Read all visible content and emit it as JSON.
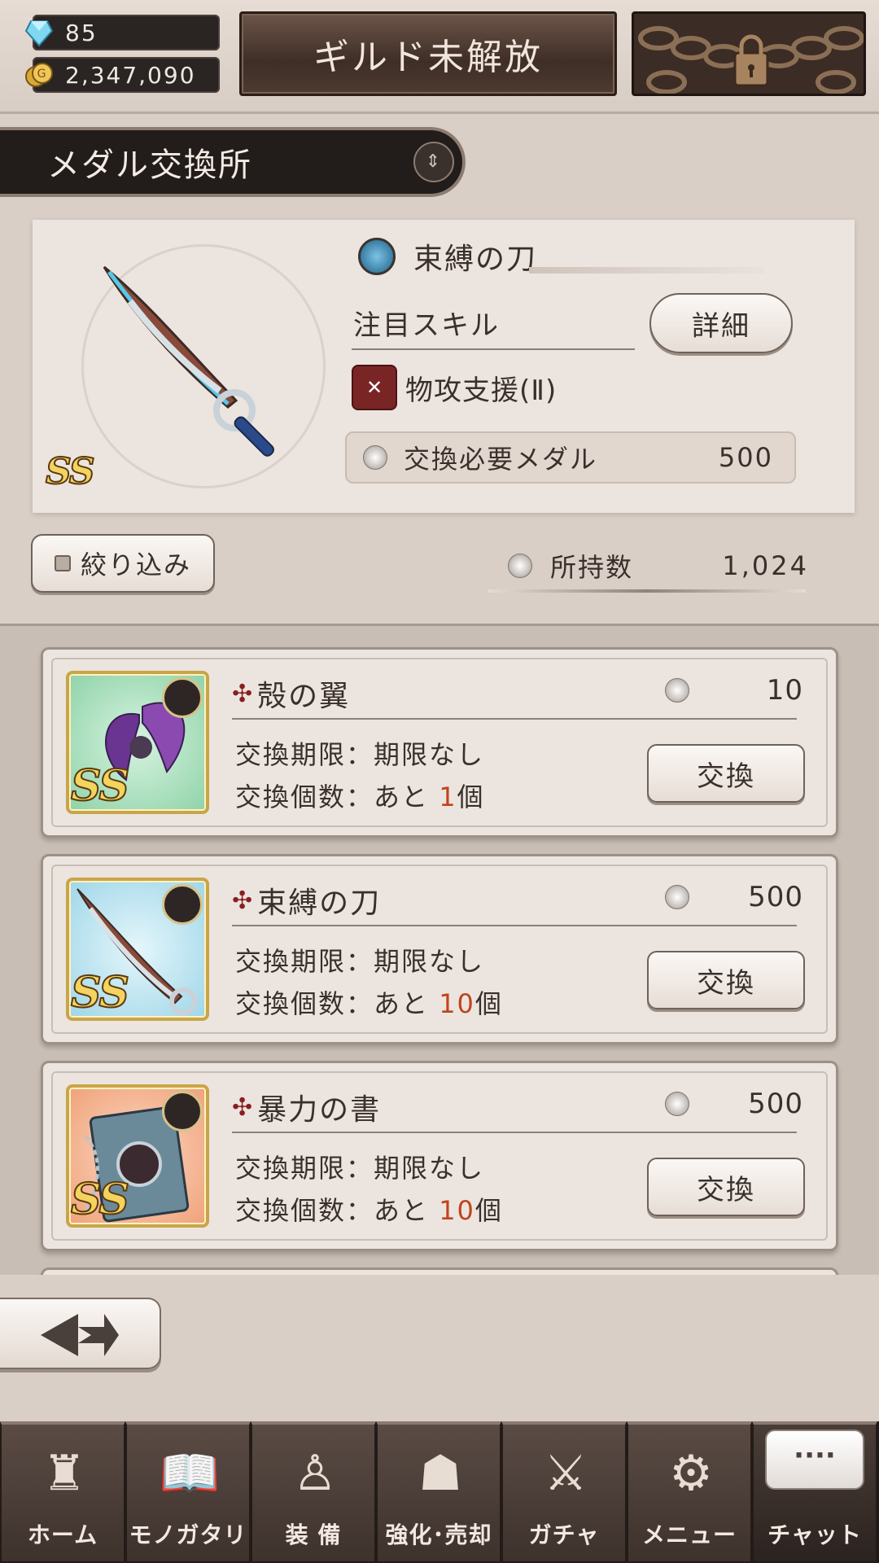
{
  "header": {
    "gems": "85",
    "coins": "2,347,090",
    "guild_button": "ギルド未解放",
    "locked_icon": "padlock-chain-icon"
  },
  "section_title": "メダル交換所",
  "detail": {
    "item_name": "束縛の刀",
    "rarity": "SS",
    "skill_label": "注目スキル",
    "detail_button": "詳細",
    "skill_name": "物攻支援(Ⅱ)",
    "required_label": "交換必要メダル",
    "required_value": "500",
    "filter_button": "絞り込み",
    "owned_label": "所持数",
    "owned_value": "1,024"
  },
  "list": [
    {
      "name": "殻の翼",
      "rarity": "SS",
      "cost": "10",
      "limit_text": "交換期限：期限なし",
      "count_prefix": "交換個数：あと ",
      "count_value": "1",
      "count_suffix": "個",
      "button": "交換",
      "type_icon": "octopus-icon",
      "thumb_color": "#8fd3a8"
    },
    {
      "name": "束縛の刀",
      "rarity": "SS",
      "cost": "500",
      "limit_text": "交換期限：期限なし",
      "count_prefix": "交換個数：あと ",
      "count_value": "10",
      "count_suffix": "個",
      "button": "交換",
      "type_icon": "sword-icon",
      "thumb_color": "#9fd6e8"
    },
    {
      "name": "暴力の書",
      "rarity": "SS",
      "cost": "500",
      "limit_text": "交換期限：期限なし",
      "count_prefix": "交換個数：あと ",
      "count_value": "10",
      "count_suffix": "個",
      "button": "交換",
      "type_icon": "book-icon",
      "thumb_color": "#f0a27a"
    }
  ],
  "nav": [
    {
      "label": "ホーム",
      "icon": "castle-icon"
    },
    {
      "label": "モノガタリ",
      "icon": "open-book-icon"
    },
    {
      "label": "装 備",
      "icon": "puppet-icon"
    },
    {
      "label": "強化･売却",
      "icon": "mask-icon"
    },
    {
      "label": "ガチャ",
      "icon": "crossed-swords-icon"
    },
    {
      "label": "メニュー",
      "icon": "gears-icon"
    },
    {
      "label": "チャット",
      "icon": "chat-bubble-icon",
      "bubble": "····"
    }
  ]
}
